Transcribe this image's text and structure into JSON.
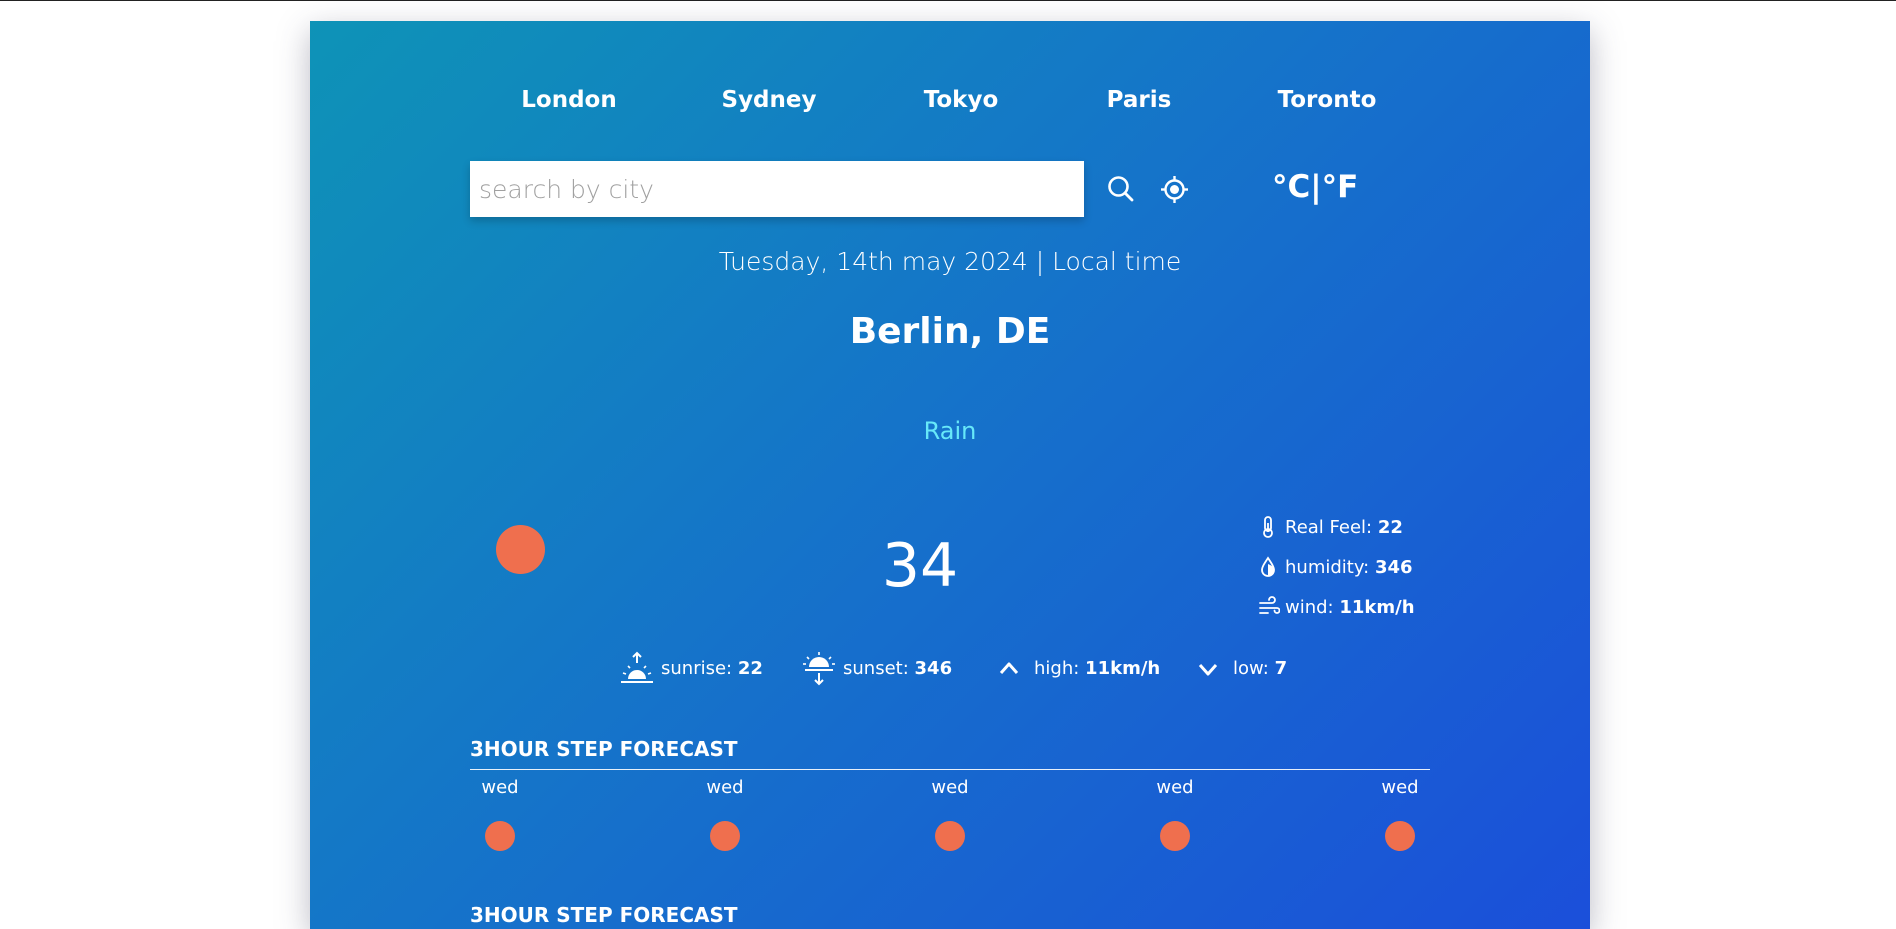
{
  "nav": {
    "cities": [
      "London",
      "Sydney",
      "Tokyo",
      "Paris",
      "Toronto"
    ]
  },
  "search": {
    "placeholder": "search by city",
    "value": ""
  },
  "units": {
    "label": "°C|°F"
  },
  "header": {
    "date": "Tuesday, 14th may 2024 | Local time",
    "location": "Berlin, DE"
  },
  "current": {
    "condition": "Rain",
    "temperature": "34",
    "icon": "weather-icon-circle"
  },
  "details": {
    "real_feel_label": "Real Feel:",
    "real_feel_value": "22",
    "humidity_label": "humidity:",
    "humidity_value": "346",
    "wind_label": "wind:",
    "wind_value": "11km/h"
  },
  "sun": {
    "sunrise_label": "sunrise:",
    "sunrise_value": "22",
    "sunset_label": "sunset:",
    "sunset_value": "346",
    "high_label": "high:",
    "high_value": "11km/h",
    "low_label": "low:",
    "low_value": "7"
  },
  "forecast_hourly": {
    "title": "3HOUR STEP FORECAST",
    "items": [
      {
        "label": "wed"
      },
      {
        "label": "wed"
      },
      {
        "label": "wed"
      },
      {
        "label": "wed"
      },
      {
        "label": "wed"
      }
    ]
  },
  "forecast_daily": {
    "title": "3HOUR STEP FORECAST"
  },
  "colors": {
    "gradient_start": "#0e93b7",
    "gradient_end": "#1b4fda",
    "icon_orange": "#ef6f4e",
    "condition_cyan": "#67e8f9"
  }
}
